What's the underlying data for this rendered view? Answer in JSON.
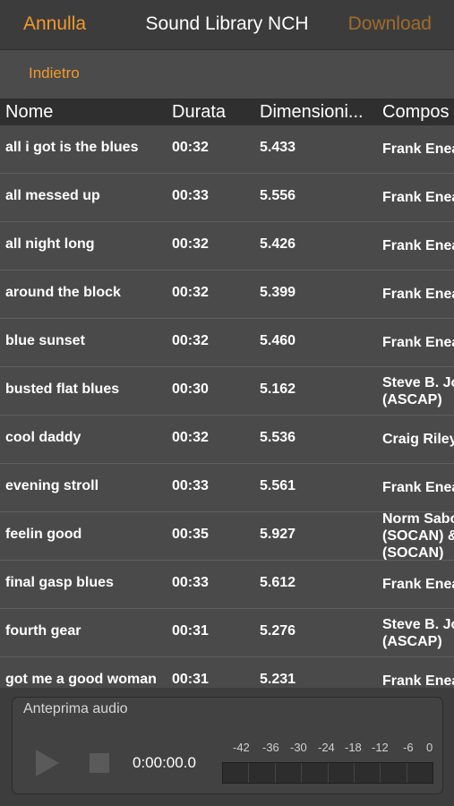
{
  "topbar": {
    "cancel": "Annulla",
    "title": "Sound Library NCH",
    "download": "Download"
  },
  "subbar": {
    "back": "Indietro"
  },
  "columns": [
    "Nome",
    "Durata",
    "Dimensioni...",
    "Compos"
  ],
  "rows": [
    {
      "name": "all i got is the blues",
      "duration": "00:32",
      "size": "5.433",
      "composer": "Frank Enea"
    },
    {
      "name": "all messed up",
      "duration": "00:33",
      "size": "5.556",
      "composer": "Frank Enea"
    },
    {
      "name": "all night long",
      "duration": "00:32",
      "size": "5.426",
      "composer": "Frank Enea"
    },
    {
      "name": "around the block",
      "duration": "00:32",
      "size": "5.399",
      "composer": "Frank Enea"
    },
    {
      "name": "blue sunset",
      "duration": "00:32",
      "size": "5.460",
      "composer": "Frank Enea"
    },
    {
      "name": "busted flat blues",
      "duration": "00:30",
      "size": "5.162",
      "composer": "Steve B. Jo\n(ASCAP)"
    },
    {
      "name": "cool daddy",
      "duration": "00:32",
      "size": "5.536",
      "composer": "Craig Riley"
    },
    {
      "name": "evening stroll",
      "duration": "00:33",
      "size": "5.561",
      "composer": "Frank Enea"
    },
    {
      "name": "feelin good",
      "duration": "00:35",
      "size": "5.927",
      "composer": "Norm Sabo\n(SOCAN) &\n(SOCAN)"
    },
    {
      "name": "final gasp blues",
      "duration": "00:33",
      "size": "5.612",
      "composer": "Frank Enea"
    },
    {
      "name": "fourth gear",
      "duration": "00:31",
      "size": "5.276",
      "composer": "Steve B. Jo\n(ASCAP)"
    },
    {
      "name": "got me a good woman",
      "duration": "00:31",
      "size": "5.231",
      "composer": "Frank Enea"
    }
  ],
  "preview": {
    "label": "Anteprima audio",
    "time": "0:00:00.0",
    "scale": [
      "-42",
      "-36",
      "-30",
      "-24",
      "-18",
      "-12",
      "-6",
      "0"
    ],
    "play_icon": "play-icon",
    "stop_icon": "stop-icon"
  }
}
